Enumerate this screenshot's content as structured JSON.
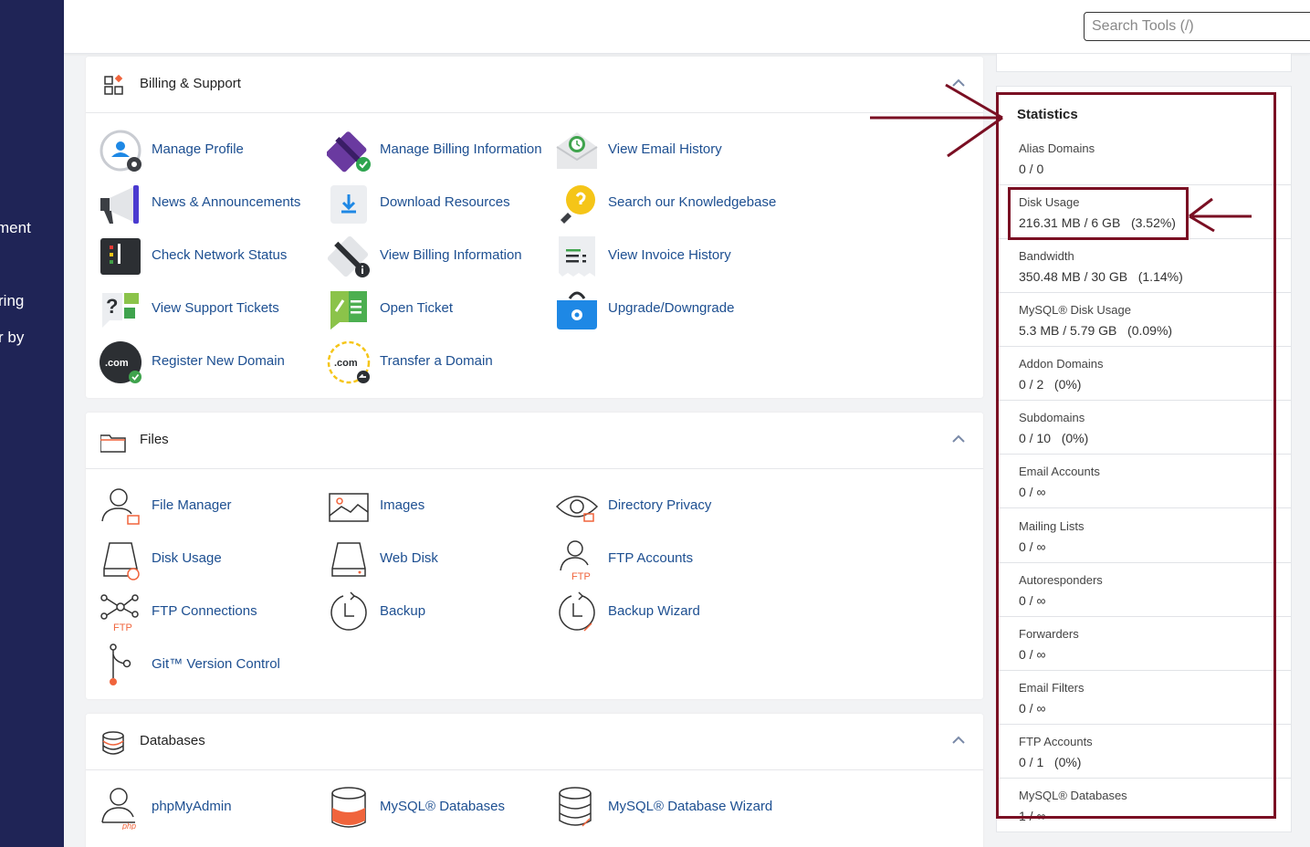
{
  "sidebar": {
    "fragments": [
      "ment",
      "ring",
      "r by"
    ]
  },
  "search": {
    "placeholder": "Search Tools (/)"
  },
  "billing": {
    "title": "Billing & Support",
    "items": [
      {
        "label": "Manage Profile",
        "icon": "manage-profile-icon"
      },
      {
        "label": "Manage Billing Information",
        "icon": "credit-card-icon"
      },
      {
        "label": "View Email History",
        "icon": "email-history-icon"
      },
      {
        "label": "News & Announcements",
        "icon": "megaphone-icon"
      },
      {
        "label": "Download Resources",
        "icon": "download-icon"
      },
      {
        "label": "Search our Knowledgebase",
        "icon": "lightbulb-icon"
      },
      {
        "label": "Check Network Status",
        "icon": "network-status-icon"
      },
      {
        "label": "View Billing Information",
        "icon": "billing-info-icon"
      },
      {
        "label": "View Invoice History",
        "icon": "invoice-icon"
      },
      {
        "label": "View Support Tickets",
        "icon": "support-tickets-icon"
      },
      {
        "label": "Open Ticket",
        "icon": "ticket-icon"
      },
      {
        "label": "Upgrade/Downgrade",
        "icon": "upgrade-bag-icon"
      },
      {
        "label": "Register New Domain",
        "icon": "register-domain-icon"
      },
      {
        "label": "Transfer a Domain",
        "icon": "transfer-domain-icon"
      }
    ]
  },
  "files": {
    "title": "Files",
    "items": [
      {
        "label": "File Manager",
        "icon": "file-manager-icon"
      },
      {
        "label": "Images",
        "icon": "images-icon"
      },
      {
        "label": "Directory Privacy",
        "icon": "eye-icon"
      },
      {
        "label": "Disk Usage",
        "icon": "disk-usage-icon"
      },
      {
        "label": "Web Disk",
        "icon": "web-disk-icon"
      },
      {
        "label": "FTP Accounts",
        "icon": "ftp-accounts-icon"
      },
      {
        "label": "FTP Connections",
        "icon": "ftp-connections-icon"
      },
      {
        "label": "Backup",
        "icon": "backup-icon"
      },
      {
        "label": "Backup Wizard",
        "icon": "backup-wizard-icon"
      },
      {
        "label": "Git™ Version Control",
        "icon": "git-icon"
      }
    ]
  },
  "databases": {
    "title": "Databases",
    "items": [
      {
        "label": "phpMyAdmin",
        "icon": "phpmyadmin-icon"
      },
      {
        "label": "MySQL® Databases",
        "icon": "mysql-databases-icon"
      },
      {
        "label": "MySQL® Database Wizard",
        "icon": "mysql-wizard-icon"
      }
    ]
  },
  "stats": {
    "title": "Statistics",
    "rows": [
      {
        "name": "Alias Domains",
        "value": "0 / 0"
      },
      {
        "name": "Disk Usage",
        "value": "216.31 MB / 6 GB   (3.52%)"
      },
      {
        "name": "Bandwidth",
        "value": "350.48 MB / 30 GB   (1.14%)"
      },
      {
        "name": "MySQL® Disk Usage",
        "value": "5.3 MB / 5.79 GB   (0.09%)"
      },
      {
        "name": "Addon Domains",
        "value": "0 / 2   (0%)"
      },
      {
        "name": "Subdomains",
        "value": "0 / 10   (0%)"
      },
      {
        "name": "Email Accounts",
        "value": "0 / ∞"
      },
      {
        "name": "Mailing Lists",
        "value": "0 / ∞"
      },
      {
        "name": "Autoresponders",
        "value": "0 / ∞"
      },
      {
        "name": "Forwarders",
        "value": "0 / ∞"
      },
      {
        "name": "Email Filters",
        "value": "0 / ∞"
      },
      {
        "name": "FTP Accounts",
        "value": "0 / 1   (0%)"
      },
      {
        "name": "MySQL® Databases",
        "value": "1 / ∞"
      }
    ]
  },
  "colors": {
    "sidebar": "#1f2456",
    "link": "#1d4f91",
    "annotation": "#7a0f23",
    "accent_orange": "#f0643c"
  }
}
